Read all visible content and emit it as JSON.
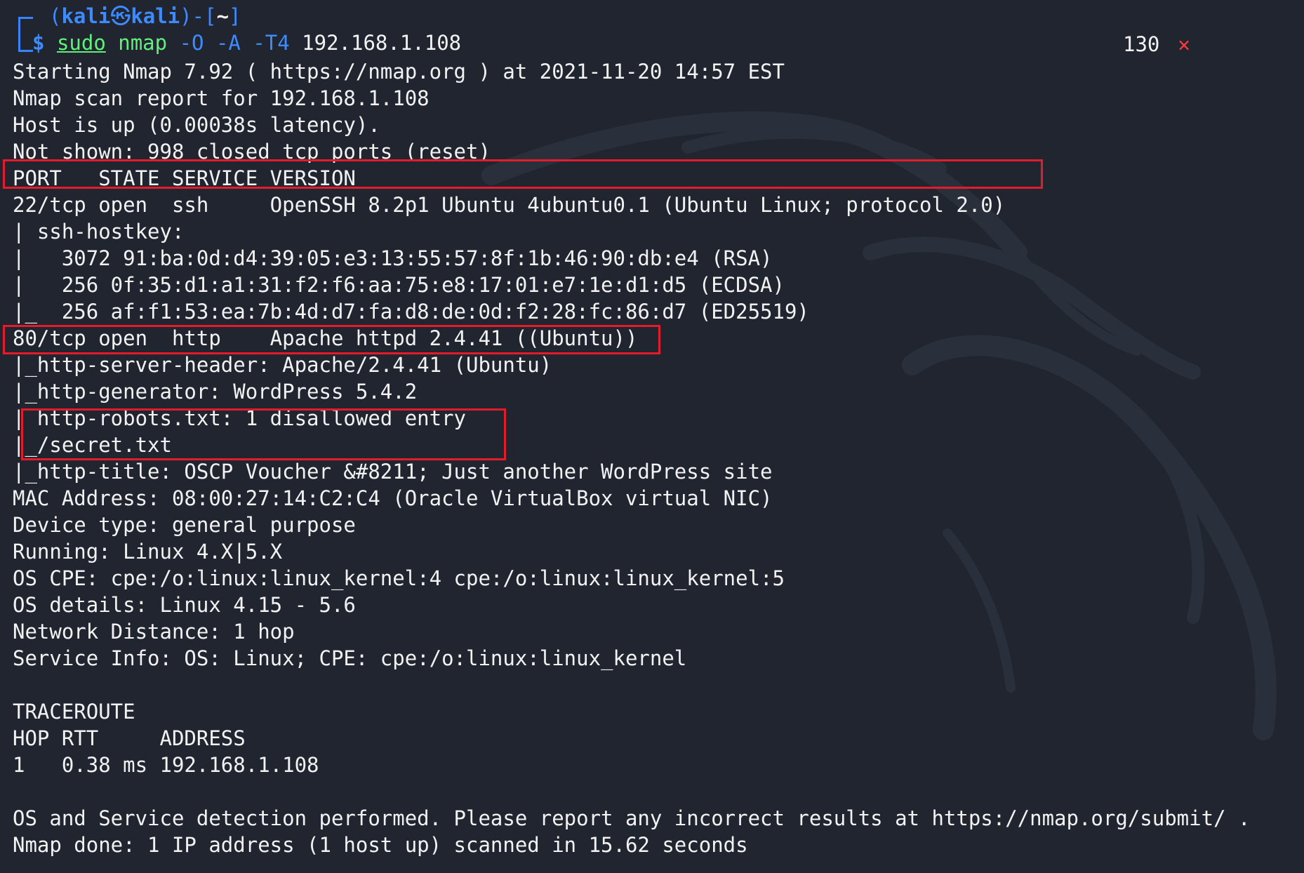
{
  "prompt": {
    "line1_prefix": "(",
    "user": "kali",
    "at_icon": "㉿",
    "host": "kali",
    "line1_mid": ")-[",
    "cwd": "~",
    "line1_suffix": "]",
    "dollar": "$",
    "cmd_sudo": "sudo",
    "cmd_nmap": "nmap",
    "flags": "-O -A -T4",
    "target": "192.168.1.108"
  },
  "status": {
    "exit_code": "130",
    "error_icon": "close-x-icon",
    "error_glyph": "✕"
  },
  "output_lines": [
    "Starting Nmap 7.92 ( https://nmap.org ) at 2021-11-20 14:57 EST",
    "Nmap scan report for 192.168.1.108",
    "Host is up (0.00038s latency).",
    "Not shown: 998 closed tcp ports (reset)",
    "PORT   STATE SERVICE VERSION",
    "22/tcp open  ssh     OpenSSH 8.2p1 Ubuntu 4ubuntu0.1 (Ubuntu Linux; protocol 2.0)",
    "| ssh-hostkey: ",
    "|   3072 91:ba:0d:d4:39:05:e3:13:55:57:8f:1b:46:90:db:e4 (RSA)",
    "|   256 0f:35:d1:a1:31:f2:f6:aa:75:e8:17:01:e7:1e:d1:d5 (ECDSA)",
    "|_  256 af:f1:53:ea:7b:4d:d7:fa:d8:de:0d:f2:28:fc:86:d7 (ED25519)",
    "80/tcp open  http    Apache httpd 2.4.41 ((Ubuntu))",
    "|_http-server-header: Apache/2.4.41 (Ubuntu)",
    "|_http-generator: WordPress 5.4.2",
    "| http-robots.txt: 1 disallowed entry ",
    "|_/secret.txt",
    "|_http-title: OSCP Voucher &#8211; Just another WordPress site",
    "MAC Address: 08:00:27:14:C2:C4 (Oracle VirtualBox virtual NIC)",
    "Device type: general purpose",
    "Running: Linux 4.X|5.X",
    "OS CPE: cpe:/o:linux:linux_kernel:4 cpe:/o:linux:linux_kernel:5",
    "OS details: Linux 4.15 - 5.6",
    "Network Distance: 1 hop",
    "Service Info: OS: Linux; CPE: cpe:/o:linux:linux_kernel",
    "",
    "TRACEROUTE",
    "HOP RTT     ADDRESS",
    "1   0.38 ms 192.168.1.108",
    "",
    "OS and Service detection performed. Please report any incorrect results at https://nmap.org/submit/ .",
    "Nmap done: 1 IP address (1 host up) scanned in 15.62 seconds"
  ],
  "colors": {
    "background": "#20252f",
    "prompt_blue": "#3d8bff",
    "command_green": "#61f07a",
    "highlight_red": "#e31b2a"
  }
}
